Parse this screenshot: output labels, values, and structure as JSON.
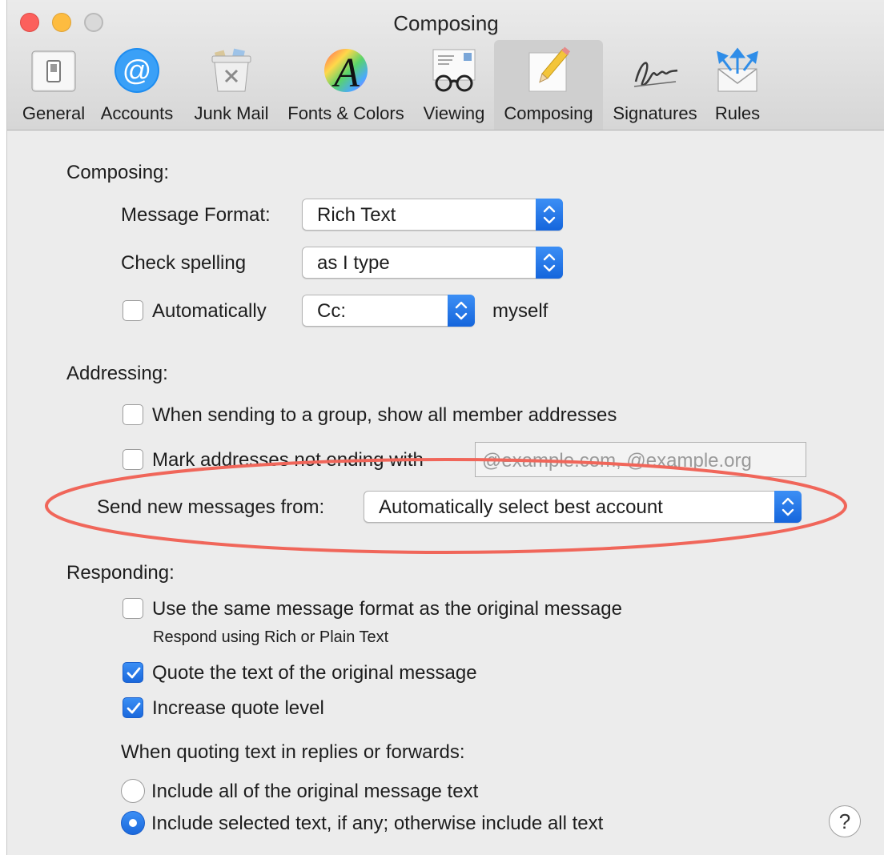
{
  "window": {
    "title": "Composing"
  },
  "toolbar": {
    "tabs": [
      {
        "label": "General",
        "icon": "general-switch-icon"
      },
      {
        "label": "Accounts",
        "icon": "at-sign-icon"
      },
      {
        "label": "Junk Mail",
        "icon": "trash-bin-icon"
      },
      {
        "label": "Fonts & Colors",
        "icon": "fonts-colors-icon"
      },
      {
        "label": "Viewing",
        "icon": "glasses-icon"
      },
      {
        "label": "Composing",
        "icon": "pencil-paper-icon",
        "selected": true
      },
      {
        "label": "Signatures",
        "icon": "signature-icon"
      },
      {
        "label": "Rules",
        "icon": "rules-envelope-icon"
      }
    ]
  },
  "composing": {
    "heading": "Composing:",
    "message_format_label": "Message Format:",
    "message_format_value": "Rich Text",
    "check_spelling_label": "Check spelling",
    "check_spelling_value": "as I type",
    "auto_cc_label": "Automatically",
    "auto_cc_checked": false,
    "auto_cc_value": "Cc:",
    "auto_cc_suffix": "myself"
  },
  "addressing": {
    "heading": "Addressing:",
    "group_label": "When sending to a group, show all member addresses",
    "group_checked": false,
    "mark_label": "Mark addresses not ending with",
    "mark_checked": false,
    "mark_placeholder": "@example.com, @example.org",
    "send_from_label": "Send new messages from:",
    "send_from_value": "Automatically select best account"
  },
  "responding": {
    "heading": "Responding:",
    "same_format_label": "Use the same message format as the original message",
    "same_format_checked": false,
    "same_format_hint": "Respond using Rich or Plain Text",
    "quote_label": "Quote the text of the original message",
    "quote_checked": true,
    "increase_label": "Increase quote level",
    "increase_checked": true,
    "quoting_heading": "When quoting text in replies or forwards:",
    "include_all_label": "Include all of the original message text",
    "include_all_selected": false,
    "include_selected_label": "Include selected text, if any; otherwise include all text",
    "include_selected_selected": true
  },
  "help": {
    "label": "?"
  },
  "colors": {
    "accent": "#1a6ae0",
    "annotation_ellipse": "#f0665a",
    "close": "#fc605c",
    "minimize": "#fdbc40"
  }
}
